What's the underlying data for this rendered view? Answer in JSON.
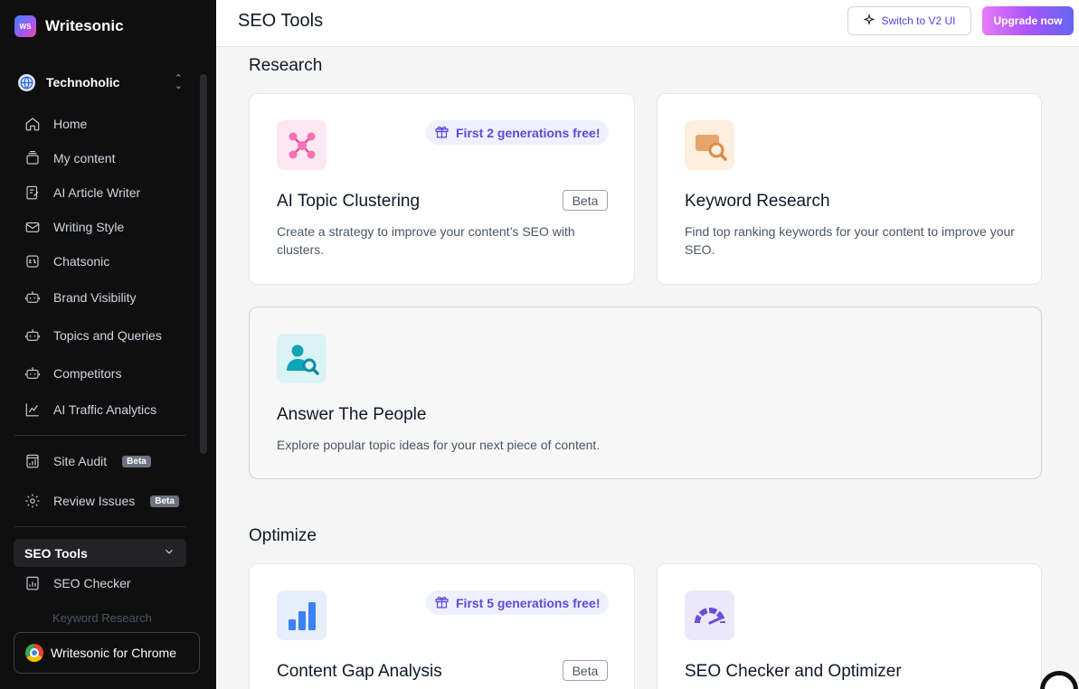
{
  "brand": {
    "logo_text": "WS",
    "name": "Writesonic"
  },
  "workspace": {
    "name": "Technoholic"
  },
  "nav": {
    "home": "Home",
    "my_content": "My content",
    "article_writer": "AI Article Writer",
    "writing_style": "Writing Style",
    "chatsonic": "Chatsonic",
    "brand_visibility": "Brand Visibility",
    "topics_queries": "Topics and Queries",
    "competitors": "Competitors",
    "traffic_analytics": "AI Traffic Analytics",
    "site_audit": "Site Audit",
    "review_issues": "Review Issues",
    "beta_badge": "Beta",
    "seo_tools": "SEO Tools",
    "seo_checker": "SEO Checker",
    "keyword_research_faded": "Keyword Research"
  },
  "chrome": {
    "label": "Writesonic for Chrome"
  },
  "header": {
    "title": "SEO Tools",
    "switch_label": "Switch to V2 UI",
    "upgrade_label": "Upgrade now"
  },
  "sections": {
    "research": "Research",
    "optimize": "Optimize"
  },
  "cards": {
    "topic_clustering": {
      "title": "AI Topic Clustering",
      "desc": "Create a strategy to improve your content’s SEO with clusters.",
      "pill": "First 2 generations free!",
      "tag": "Beta"
    },
    "keyword_research": {
      "title": "Keyword Research",
      "desc": "Find top ranking keywords for your content to improve your SEO."
    },
    "answer_people": {
      "title": "Answer The People",
      "desc": "Explore popular topic ideas for your next piece of content."
    },
    "content_gap": {
      "title": "Content Gap Analysis",
      "pill": "First 5 generations free!",
      "tag": "Beta"
    },
    "seo_checker": {
      "title": "SEO Checker and Optimizer"
    }
  }
}
